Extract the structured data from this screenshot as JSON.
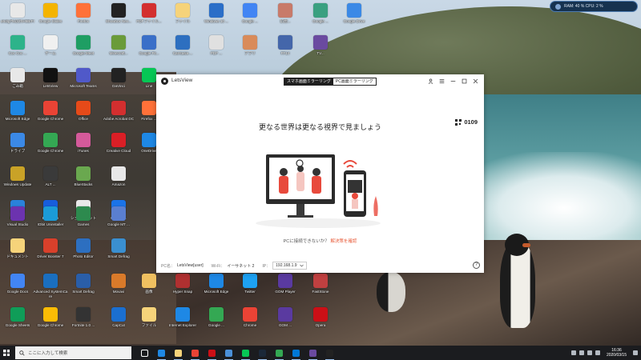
{
  "sysmon": {
    "text": "RAM: 40 %  CPU: 2 %"
  },
  "desktop": {
    "icons": [
      {
        "label": "ahdlg7fs@ZhH5BrFI",
        "color": "#e8e8e8"
      },
      {
        "label": "Google Slides",
        "color": "#f4b400"
      },
      {
        "label": "Firefox",
        "color": "#ff7139"
      },
      {
        "label": "Showbox Nex...",
        "color": "#222222"
      },
      {
        "label": "PDFファイル...",
        "color": "#d32f2f"
      },
      {
        "label": "ファイル",
        "color": "#f6d37a"
      },
      {
        "label": "Windows 10 ...",
        "color": "#2a6ec8"
      },
      {
        "label": "Google ...",
        "color": "#4285f4"
      },
      {
        "label": "幻想...",
        "color": "#c87a6a"
      },
      {
        "label": "Google ...",
        "color": "#3aa080"
      },
      {
        "label": "Google Drive",
        "color": "#3b89e6"
      },
      {
        "label": "Coc Coc ...",
        "color": "#2db38a"
      },
      {
        "label": "ゲーム",
        "color": "#f0f0f0"
      },
      {
        "label": "Google Meet",
        "color": "#1e9e63"
      },
      {
        "label": "Minecraft...",
        "color": "#6a9b3a"
      },
      {
        "label": "Google Fit...",
        "color": "#3a6fc8"
      },
      {
        "label": "Camtasia ...",
        "color": "#2d6fc0"
      },
      {
        "label": "PDF ...",
        "color": "#e0e0e0"
      },
      {
        "label": "アプリ",
        "color": "#d98b5a"
      },
      {
        "label": "FF14",
        "color": "#4466aa"
      },
      {
        "label": "TV...",
        "color": "#6a4aa0"
      },
      {
        "label": "ごみ箱",
        "color": "#e8e8e8"
      },
      {
        "label": "LetsView",
        "color": "#111111"
      },
      {
        "label": "Microsoft Teams",
        "color": "#5059c9"
      },
      {
        "label": "DaVinci",
        "color": "#222222"
      },
      {
        "label": "Line",
        "color": "#06c755"
      },
      {
        "label": "Microsoft Edge",
        "color": "#1e88e5"
      },
      {
        "label": "Google Chrome",
        "color": "#ea4335"
      },
      {
        "label": "Office",
        "color": "#e64a19"
      },
      {
        "label": "Adobe Acrobat DC",
        "color": "#d32f2f"
      },
      {
        "label": "Firefox ...",
        "color": "#ff7139"
      },
      {
        "label": "ドライブ",
        "color": "#3b89e6"
      },
      {
        "label": "Google Chrome",
        "color": "#34a853"
      },
      {
        "label": "iTunes",
        "color": "#d45a9a"
      },
      {
        "label": "Creative Cloud",
        "color": "#da1f26"
      },
      {
        "label": "OneDrive",
        "color": "#1e88e5"
      },
      {
        "label": "Windows Update",
        "color": "#c9a227"
      },
      {
        "label": "ALT ...",
        "color": "#3a3a3a"
      },
      {
        "label": "BlueStacks",
        "color": "#6aa84f"
      },
      {
        "label": "Amazon",
        "color": "#e8e8e8"
      },
      {
        "label": "NERO ...",
        "color": "#2a82da"
      },
      {
        "label": "Bitwarden",
        "color": "#175ddc"
      },
      {
        "label": "ショートカット",
        "color": "#e8e8e8"
      },
      {
        "label": "Google ...",
        "color": "#1a73e8"
      },
      {
        "label": "Visual Studio",
        "color": "#6c33af"
      },
      {
        "label": "IObit Uninstaller",
        "color": "#1b9bd7"
      },
      {
        "label": "Games",
        "color": "#2d8a4e"
      },
      {
        "label": "Google MT ...",
        "color": "#5a7fd0"
      },
      {
        "label": "ドキュメント",
        "color": "#f6d37a"
      },
      {
        "label": "Driver Booster 7",
        "color": "#d9402b"
      },
      {
        "label": "Photo Editor",
        "color": "#2d6fc0"
      },
      {
        "label": "Smart Defrag",
        "color": "#3a8fd0"
      },
      {
        "label": "Google Docs",
        "color": "#4285f4"
      },
      {
        "label": "Advanced SystemCare",
        "color": "#1a6fc0"
      },
      {
        "label": "Smart Defrag",
        "color": "#2a5ea8"
      },
      {
        "label": "Movavi",
        "color": "#d97a2a"
      },
      {
        "label": "画像",
        "color": "#f0c060"
      },
      {
        "label": "Hyper Snap",
        "color": "#b03030"
      },
      {
        "label": "Microsoft Edge",
        "color": "#1e88e5"
      },
      {
        "label": "Twitter",
        "color": "#1da1f2"
      },
      {
        "label": "GOM Player",
        "color": "#5a3aa0"
      },
      {
        "label": "FastStone",
        "color": "#c04040"
      },
      {
        "label": "Google Sheets",
        "color": "#0f9d58"
      },
      {
        "label": "Google Chrome",
        "color": "#fbbc05"
      },
      {
        "label": "Fortnite 1.0 ...",
        "color": "#333333"
      },
      {
        "label": "CapCut",
        "color": "#1b6fd0"
      },
      {
        "label": "ファイル",
        "color": "#f6d37a"
      },
      {
        "label": "Internet Explorer",
        "color": "#1e88e5"
      },
      {
        "label": "Google ...",
        "color": "#34a853"
      },
      {
        "label": "Chrome",
        "color": "#ea4335"
      },
      {
        "label": "GOM ...",
        "color": "#5a3aa0"
      },
      {
        "label": "Opera",
        "color": "#cc0f16"
      }
    ]
  },
  "window": {
    "app_name": "LetsView",
    "tabs": [
      "スマホ画面ミラーリング",
      "PC画面ミラーリング"
    ],
    "headline": "更なる世界は更なる視界で見ましょう",
    "code": "0109",
    "help_prefix": "PCに接続できないか？",
    "help_link": "解決策を確認",
    "status": {
      "pc_label": "PC名：",
      "pc_value": "LetsView[user]",
      "wifi_label": "Wi-Fi：",
      "wifi_value": "イーサネット 2",
      "ip_label": "IP：",
      "ip_value": "192.168.1.9"
    }
  },
  "taskbar": {
    "search_placeholder": "ここに入力して検索",
    "time": "16:36",
    "date": "2020/03/15",
    "apps": [
      {
        "name": "task-view",
        "color": "#ffffff"
      },
      {
        "name": "edge",
        "color": "#1e88e5"
      },
      {
        "name": "explorer",
        "color": "#f6d37a"
      },
      {
        "name": "chrome",
        "color": "#ea4335"
      },
      {
        "name": "opera",
        "color": "#cc0f16"
      },
      {
        "name": "mail",
        "color": "#4a90d9"
      },
      {
        "name": "line",
        "color": "#06c755"
      },
      {
        "name": "steam",
        "color": "#1b2838"
      },
      {
        "name": "chrome-2",
        "color": "#34a853"
      },
      {
        "name": "store",
        "color": "#0078d7"
      },
      {
        "name": "photos",
        "color": "#6a4aa0"
      },
      {
        "name": "letsview",
        "color": "#222222"
      }
    ]
  }
}
